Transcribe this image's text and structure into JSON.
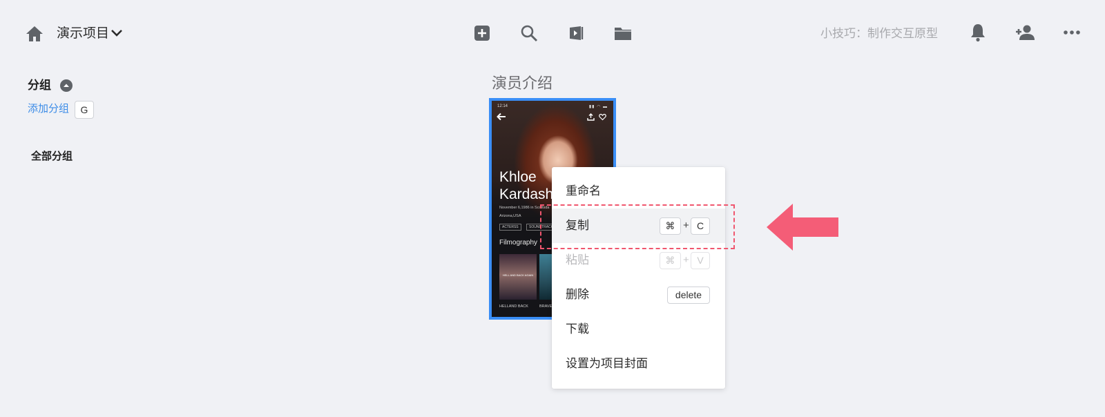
{
  "header": {
    "project_name": "演示项目",
    "tip": "小技巧：制作交互原型",
    "tools": [
      "add-icon",
      "search-icon",
      "preview-icon",
      "folder-icon"
    ],
    "right_icons": [
      "bell-icon",
      "add-user-icon",
      "more-icon"
    ]
  },
  "sidebar": {
    "title": "分组",
    "add_group_label": "添加分组",
    "add_group_key": "G",
    "all_groups_label": "全部分组"
  },
  "page": {
    "title": "演员介绍",
    "thumbnail": {
      "status_time": "12:14",
      "name": "Khloe\nKardash",
      "bio_line1": "November 6,1986 in Scottsda",
      "bio_line2": "Arizona,USA",
      "tags": [
        "ACTERSS",
        "SOUNDTRACK"
      ],
      "section": "Filmography",
      "film1_title": "HELL AND BACK AGAIN",
      "film1_label": "HELLAND BACK",
      "film2_label": "BRAVE"
    }
  },
  "context_menu": {
    "items": [
      {
        "label": "重命名",
        "state": "normal"
      },
      {
        "label": "复制",
        "state": "active",
        "key1": "⌘",
        "plus": "+",
        "key2": "C"
      },
      {
        "label": "粘贴",
        "state": "disabled",
        "key1": "⌘",
        "plus": "+",
        "key2": "V"
      },
      {
        "label": "删除",
        "state": "normal",
        "key": "delete"
      },
      {
        "label": "下载",
        "state": "normal"
      },
      {
        "label": "设置为项目封面",
        "state": "normal"
      }
    ]
  },
  "colors": {
    "background": "#f0f1f5",
    "accent_blue": "#3a8ef6",
    "link_blue": "#3c8ce7",
    "annotation_red": "#f0566e",
    "icon_gray": "#5f6368"
  }
}
